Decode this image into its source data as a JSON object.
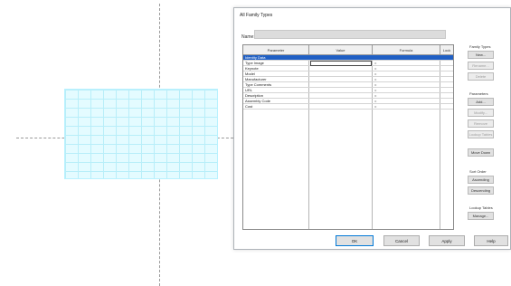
{
  "dialog": {
    "title": "All Family Types",
    "name_label": "Name:",
    "name_value": ""
  },
  "table": {
    "columns": [
      "Parameter",
      "Value",
      "Formula",
      "Lock"
    ],
    "rows": [
      {
        "name": "Identity Data",
        "type": "group"
      },
      {
        "name": "Type Image",
        "type": "param",
        "formula": "=",
        "editing": true
      },
      {
        "name": "Keynote",
        "type": "param",
        "formula": "="
      },
      {
        "name": "Model",
        "type": "param",
        "formula": "="
      },
      {
        "name": "Manufacturer",
        "type": "param",
        "formula": "="
      },
      {
        "name": "Type Comments",
        "type": "param",
        "formula": "="
      },
      {
        "name": "URL",
        "type": "param",
        "formula": "="
      },
      {
        "name": "Description",
        "type": "param",
        "formula": "="
      },
      {
        "name": "Assembly Code",
        "type": "param",
        "formula": "="
      },
      {
        "name": "Cost",
        "type": "param",
        "formula": "="
      }
    ]
  },
  "side_panel": {
    "family_types_label": "Family Types",
    "new_label": "New...",
    "rename_label": "Rename...",
    "delete_label": "Delete",
    "parameters_label": "Parameters",
    "add_label": "Add...",
    "modify_label": "Modify...",
    "remove_label": "Remove",
    "lookup_label": "Lookup Tables",
    "move_down_label": "Move Down",
    "sort_order_label": "Sort Order",
    "ascending_label": "Ascending",
    "descending_label": "Descending",
    "lookup_tables_label": "Lookup Tables",
    "manage_label": "Manage..."
  },
  "buttons": {
    "ok": "OK",
    "cancel": "Cancel",
    "apply": "Apply",
    "help": "Help"
  },
  "colors": {
    "selection": "#1f5fc4",
    "grid_family": "#e4fbff"
  }
}
